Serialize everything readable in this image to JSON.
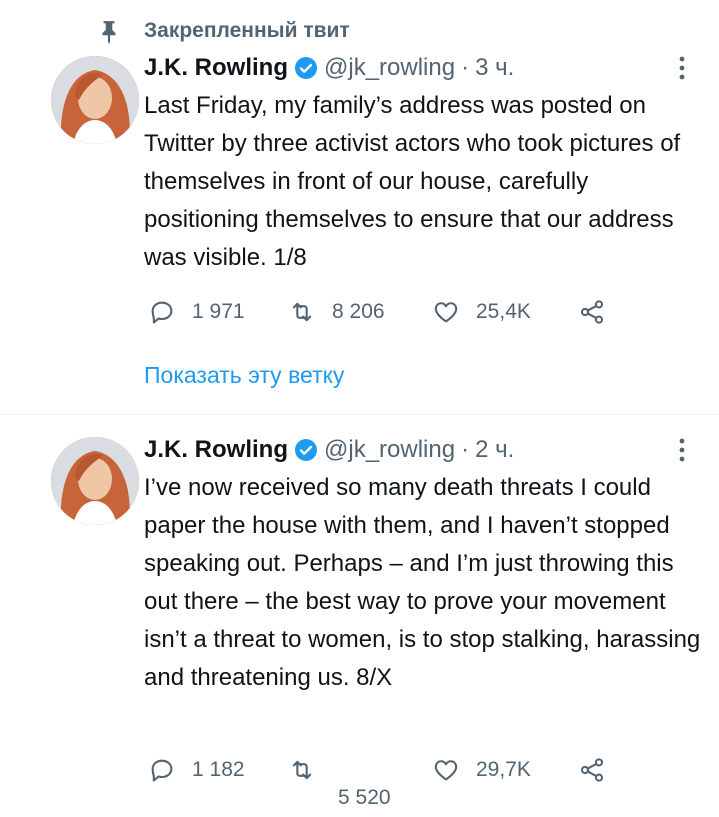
{
  "pinned_label": "Закрепленный твит",
  "tweets": [
    {
      "name": "J.K. Rowling",
      "handle": "@jk_rowling",
      "separator": "·",
      "time": "3 ч.",
      "text": "Last Friday, my family’s address was posted on Twitter by three activist actors who took pictures of themselves in front of our house, carefully positioning themselves to ensure that our address was visible. 1/8",
      "replies": "1 971",
      "retweets": "8 206",
      "likes": "25,4K",
      "show_thread": "Показать эту ветку"
    },
    {
      "name": "J.K. Rowling",
      "handle": "@jk_rowling",
      "separator": "·",
      "time": "2 ч.",
      "text": "I’ve now received so many death threats I could paper the house with them, and I haven’t stopped speaking out. Perhaps – and I’m just throwing this out there – the best way to prove your movement isn’t a threat to women, is to stop stalking, harassing and threatening us. 8/X",
      "replies": "1 182",
      "retweets": "5 520",
      "likes": "29,7K"
    }
  ],
  "colors": {
    "accent": "#1d9bf0",
    "muted": "#536471",
    "text": "#0f1419",
    "divider": "#eff3f4"
  },
  "icons": [
    "pin-icon",
    "verified-badge-icon",
    "more-options-icon",
    "reply-icon",
    "retweet-icon",
    "like-icon",
    "share-icon"
  ]
}
